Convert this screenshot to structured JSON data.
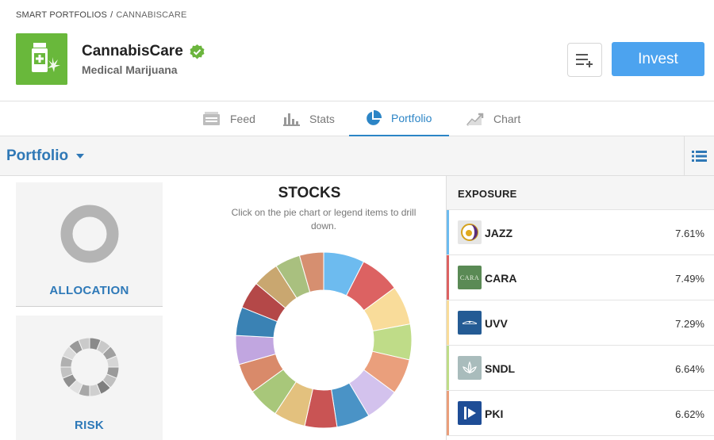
{
  "breadcrumb": {
    "parent": "SMART PORTFOLIOS",
    "separator": "/",
    "current": "CANNABISCARE"
  },
  "header": {
    "name": "CannabisCare",
    "subtitle": "Medical Marijuana",
    "invest_label": "Invest"
  },
  "tabs": [
    {
      "label": "Feed",
      "icon": "feed-icon",
      "active": false
    },
    {
      "label": "Stats",
      "icon": "stats-icon",
      "active": false
    },
    {
      "label": "Portfolio",
      "icon": "pie-icon",
      "active": true
    },
    {
      "label": "Chart",
      "icon": "chart-icon",
      "active": false
    }
  ],
  "portfolio_bar": {
    "title": "Portfolio"
  },
  "cards": {
    "allocation": "ALLOCATION",
    "risk": "RISK"
  },
  "stocks": {
    "title": "STOCKS",
    "subtitle": "Click on the pie chart or legend items to drill down.",
    "segments": [
      {
        "value": 7.61,
        "color": "#6dbbef"
      },
      {
        "value": 7.49,
        "color": "#dc6262"
      },
      {
        "value": 7.29,
        "color": "#f9dc9a"
      },
      {
        "value": 6.64,
        "color": "#bfdc88"
      },
      {
        "value": 6.62,
        "color": "#ea9f7c"
      },
      {
        "value": 6.4,
        "color": "#d3c2ed"
      },
      {
        "value": 6.2,
        "color": "#4a93c6"
      },
      {
        "value": 6.0,
        "color": "#c95454"
      },
      {
        "value": 5.9,
        "color": "#e3c17e"
      },
      {
        "value": 5.8,
        "color": "#a8c77a"
      },
      {
        "value": 5.6,
        "color": "#d98a6a"
      },
      {
        "value": 5.4,
        "color": "#c1a6e0"
      },
      {
        "value": 5.3,
        "color": "#3a82b4"
      },
      {
        "value": 5.1,
        "color": "#b44848"
      },
      {
        "value": 4.9,
        "color": "#c9a770"
      },
      {
        "value": 4.7,
        "color": "#a9c07f"
      },
      {
        "value": 4.5,
        "color": "#d68f70"
      }
    ]
  },
  "exposure": {
    "title": "EXPOSURE",
    "rows": [
      {
        "ticker": "JAZZ",
        "pct": "7.61%",
        "color": "#6dbbef",
        "logo": "jazz-logo"
      },
      {
        "ticker": "CARA",
        "pct": "7.49%",
        "color": "#dc6262",
        "logo": "cara-logo",
        "logo_text": "CARA"
      },
      {
        "ticker": "UVV",
        "pct": "7.29%",
        "color": "#f9dc9a",
        "logo": "uvv-logo"
      },
      {
        "ticker": "SNDL",
        "pct": "6.64%",
        "color": "#bfdc88",
        "logo": "sndl-logo"
      },
      {
        "ticker": "PKI",
        "pct": "6.62%",
        "color": "#ea9f7c",
        "logo": "pki-logo"
      }
    ]
  }
}
